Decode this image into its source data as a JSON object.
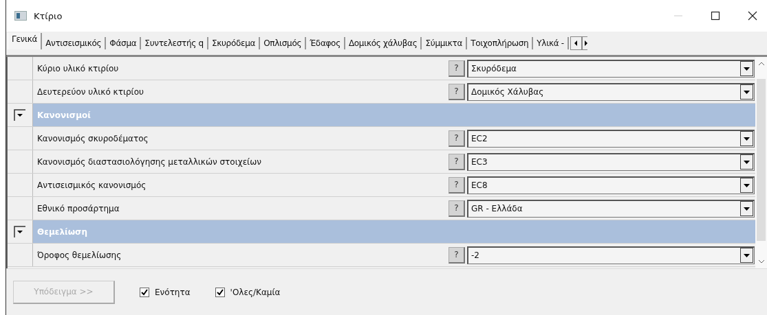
{
  "window": {
    "title": "Κτίριο"
  },
  "tabs": [
    {
      "label": "Γενικά",
      "selected": true
    },
    {
      "label": "Αντισεισμικός",
      "selected": false
    },
    {
      "label": "Φάσμα",
      "selected": false
    },
    {
      "label": "Συντελεστής q",
      "selected": false
    },
    {
      "label": "Σκυρόδεμα",
      "selected": false
    },
    {
      "label": "Οπλισμός",
      "selected": false
    },
    {
      "label": "Έδαφος",
      "selected": false
    },
    {
      "label": "Δομικός χάλυβας",
      "selected": false
    },
    {
      "label": "Σύμμικτα",
      "selected": false
    },
    {
      "label": "Τοιχοπλήρωση",
      "selected": false
    },
    {
      "label": "Υλικά -",
      "selected": false
    }
  ],
  "rows": [
    {
      "kind": "property",
      "label": "Κύριο υλικό κτιρίου",
      "help": "?",
      "value": "Σκυρόδεμα"
    },
    {
      "kind": "property",
      "label": "Δευτερεύον υλικό κτιρίου",
      "help": "?",
      "value": "Δομικός Χάλυβας"
    },
    {
      "kind": "section",
      "label": "Κανονισμοί",
      "expanded": true
    },
    {
      "kind": "property",
      "label": "Κανονισμός σκυροδέματος",
      "help": "?",
      "value": "EC2"
    },
    {
      "kind": "property",
      "label": "Κανονισμός διαστασιολόγησης μεταλλικών στοιχείων",
      "help": "?",
      "value": "EC3"
    },
    {
      "kind": "property",
      "label": "Αντισεισμικός κανονισμός",
      "help": "?",
      "value": "EC8"
    },
    {
      "kind": "property",
      "label": "Εθνικό προσάρτημα",
      "help": "?",
      "value": "GR - Ελλάδα"
    },
    {
      "kind": "section",
      "label": "Θεμελίωση",
      "expanded": true
    },
    {
      "kind": "property",
      "label": "Όροφος θεμελίωσης",
      "help": "?",
      "value": "-2"
    }
  ],
  "footer": {
    "button": {
      "label": "Υπόδειγμα >>",
      "disabled": true
    },
    "checkboxes": [
      {
        "label": "Ενότητα",
        "checked": true
      },
      {
        "label": "'Ολες/Καμία",
        "checked": true
      }
    ]
  }
}
